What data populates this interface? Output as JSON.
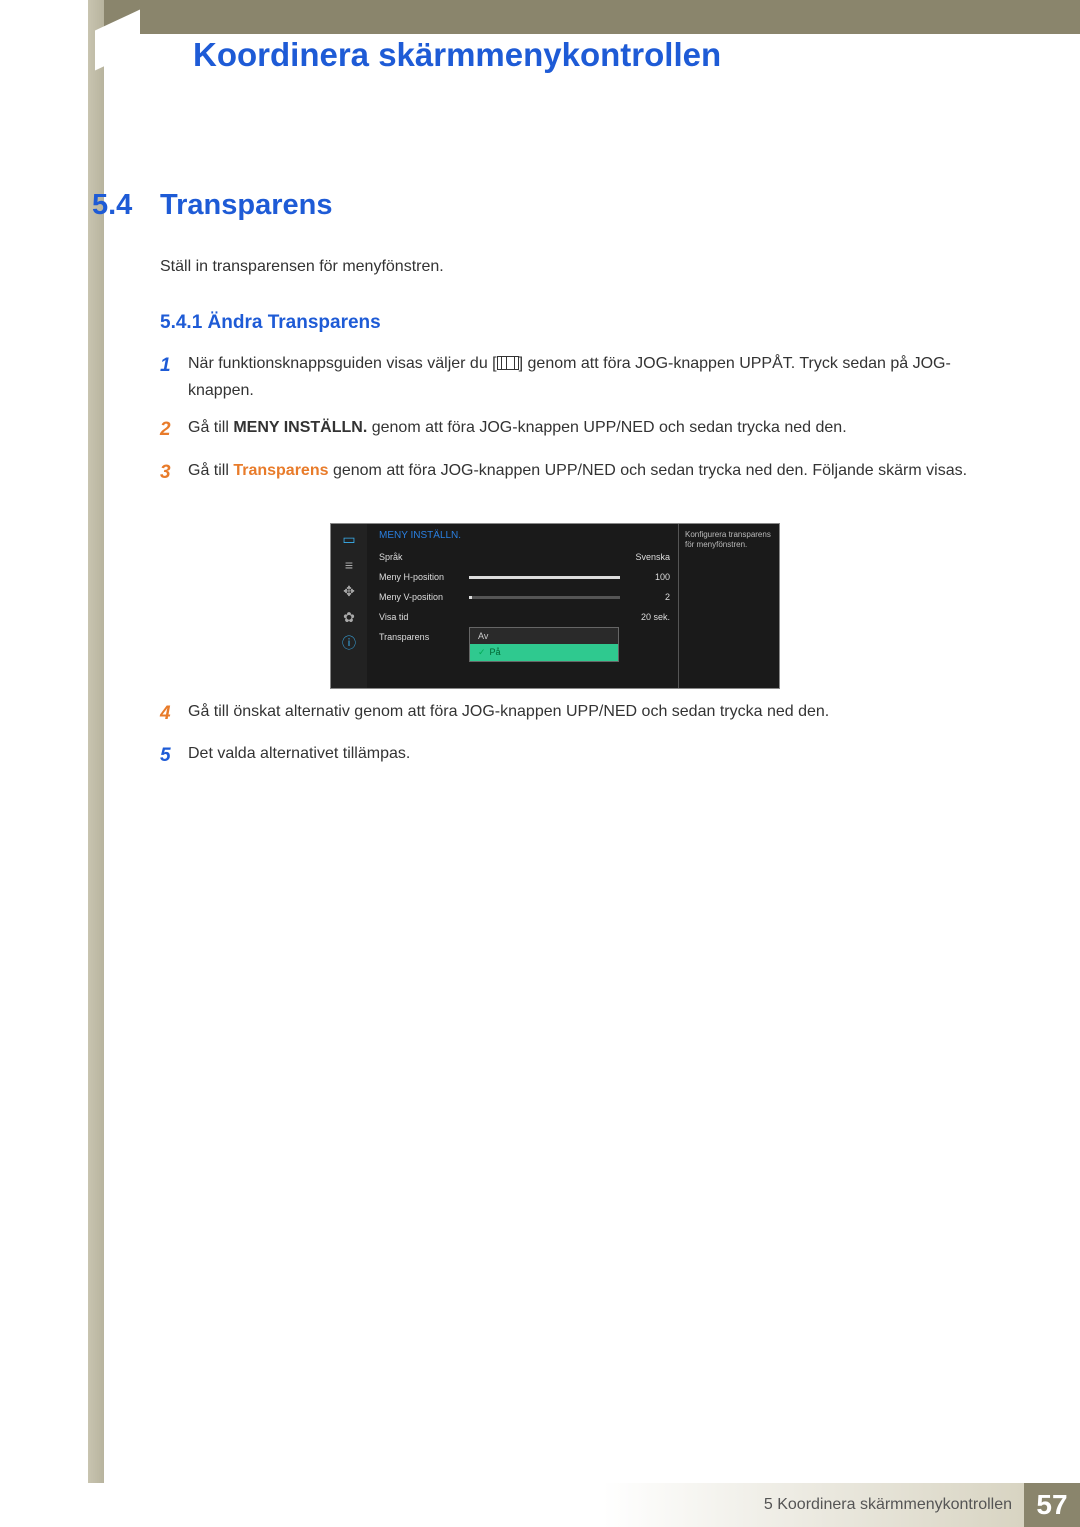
{
  "chapter_title": "Koordinera skärmmenykontrollen",
  "section": {
    "num": "5.4",
    "title": "Transparens"
  },
  "intro": "Ställ in transparensen för menyfönstren.",
  "subsection": "5.4.1  Ändra Transparens",
  "steps": {
    "s1a": "När funktionsknappsguiden visas väljer du [",
    "s1b": "] genom att föra JOG-knappen UPPÅT. Tryck sedan på JOG-knappen.",
    "s2a": "Gå till ",
    "s2b": "MENY INSTÄLLN.",
    "s2c": " genom att föra JOG-knappen UPP/NED och sedan trycka ned den.",
    "s3a": "Gå till ",
    "s3b": "Transparens",
    "s3c": " genom att föra JOG-knappen UPP/NED och sedan trycka ned den. Följande skärm visas.",
    "s4": "Gå till önskat alternativ genom att föra JOG-knappen UPP/NED och sedan trycka ned den.",
    "s5": "Det valda alternativet tillämpas."
  },
  "osd": {
    "header": "MENY INSTÄLLN.",
    "rows": {
      "r0l": "Språk",
      "r0v": "Svenska",
      "r1l": "Meny H-position",
      "r1v": "100",
      "r2l": "Meny V-position",
      "r2v": "2",
      "r3l": "Visa tid",
      "r3v": "20 sek.",
      "r4l": "Transparens"
    },
    "opt_off": "Av",
    "opt_on": "På",
    "side": "Konfigurera transparens för menyfönstren."
  },
  "footer": {
    "text": "5 Koordinera skärmmenykontrollen",
    "page": "57"
  }
}
